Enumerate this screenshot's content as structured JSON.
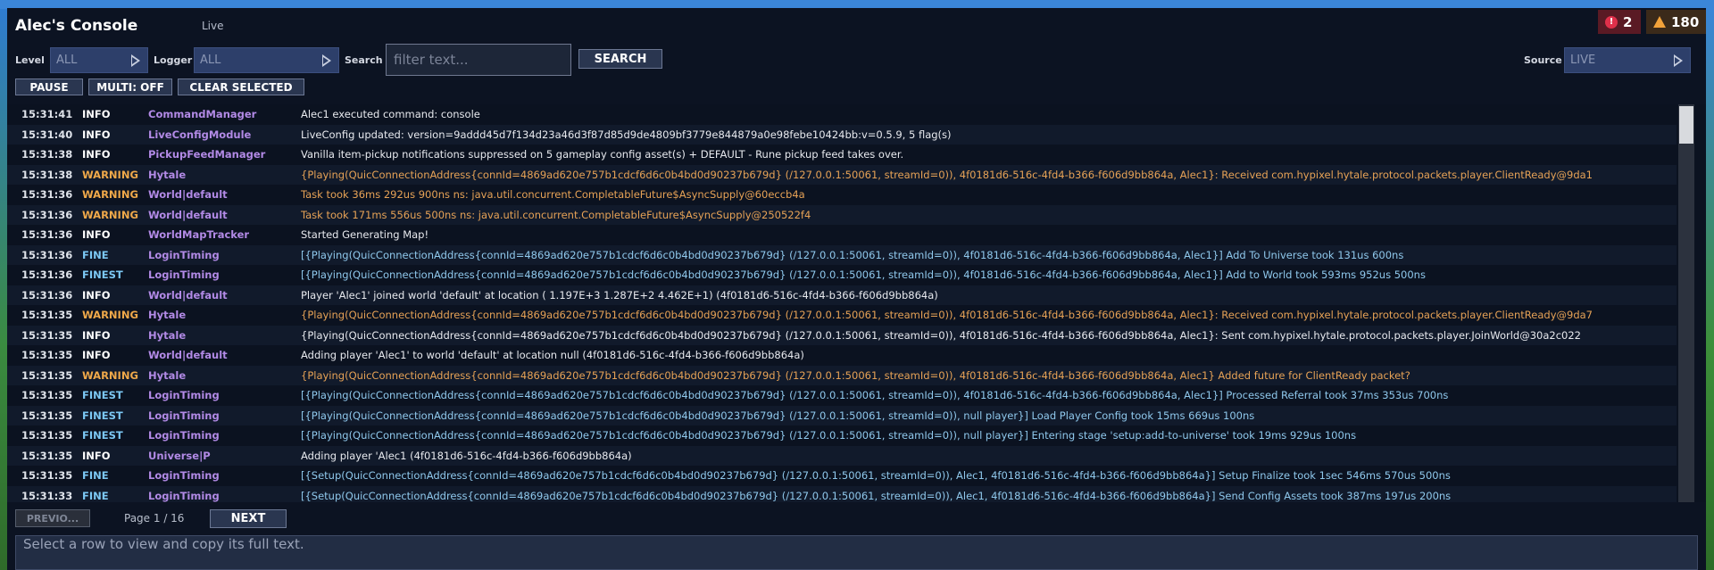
{
  "header": {
    "title": "Alec's Console",
    "status": "Live"
  },
  "counts": {
    "errors": "2",
    "warnings": "180"
  },
  "filters": {
    "level_label": "Level",
    "level_value": "ALL",
    "logger_label": "Logger",
    "logger_value": "ALL",
    "search_label": "Search",
    "search_placeholder": "filter text...",
    "search_button": "SEARCH",
    "source_label": "Source",
    "source_value": "LIVE"
  },
  "toolbar": {
    "pause": "PAUSE",
    "multi": "MULTI: OFF",
    "clear_selected": "CLEAR SELECTED"
  },
  "rows": [
    {
      "time": "15:31:41",
      "level": "INFO",
      "logger": "CommandManager",
      "message": "Alec1 executed command: console"
    },
    {
      "time": "15:31:40",
      "level": "INFO",
      "logger": "LiveConfigModule",
      "message": "LiveConfig updated: version=9addd45d7f134d23a46d3f87d85d9de4809bf3779e844879a0e98febe10424bb:v=0.5.9, 5 flag(s)"
    },
    {
      "time": "15:31:38",
      "level": "INFO",
      "logger": "PickupFeedManager",
      "message": "Vanilla item-pickup notifications suppressed on 5 gameplay config asset(s) + DEFAULT - Rune pickup feed takes over."
    },
    {
      "time": "15:31:38",
      "level": "WARNING",
      "logger": "Hytale",
      "message": "{Playing(QuicConnectionAddress{connId=4869ad620e757b1cdcf6d6c0b4bd0d90237b679d} (/127.0.0.1:50061, streamId=0)), 4f0181d6-516c-4fd4-b366-f606d9bb864a, Alec1}: Received com.hypixel.hytale.protocol.packets.player.ClientReady@9da1"
    },
    {
      "time": "15:31:36",
      "level": "WARNING",
      "logger": "World|default",
      "message": "Task took 36ms 292us 900ns ns: java.util.concurrent.CompletableFuture$AsyncSupply@60eccb4a"
    },
    {
      "time": "15:31:36",
      "level": "WARNING",
      "logger": "World|default",
      "message": "Task took 171ms 556us 500ns ns: java.util.concurrent.CompletableFuture$AsyncSupply@250522f4"
    },
    {
      "time": "15:31:36",
      "level": "INFO",
      "logger": "WorldMapTracker",
      "message": "Started Generating Map!"
    },
    {
      "time": "15:31:36",
      "level": "FINE",
      "logger": "LoginTiming",
      "message": "[{Playing(QuicConnectionAddress{connId=4869ad620e757b1cdcf6d6c0b4bd0d90237b679d} (/127.0.0.1:50061, streamId=0)), 4f0181d6-516c-4fd4-b366-f606d9bb864a, Alec1}] Add To Universe took 131us 600ns"
    },
    {
      "time": "15:31:36",
      "level": "FINEST",
      "logger": "LoginTiming",
      "message": "[{Playing(QuicConnectionAddress{connId=4869ad620e757b1cdcf6d6c0b4bd0d90237b679d} (/127.0.0.1:50061, streamId=0)), 4f0181d6-516c-4fd4-b366-f606d9bb864a, Alec1}] Add to World took 593ms 952us 500ns"
    },
    {
      "time": "15:31:36",
      "level": "INFO",
      "logger": "World|default",
      "message": "Player 'Alec1' joined world 'default' at location ( 1.197E+3  1.287E+2  4.462E+1) (4f0181d6-516c-4fd4-b366-f606d9bb864a)"
    },
    {
      "time": "15:31:35",
      "level": "WARNING",
      "logger": "Hytale",
      "message": "{Playing(QuicConnectionAddress{connId=4869ad620e757b1cdcf6d6c0b4bd0d90237b679d} (/127.0.0.1:50061, streamId=0)), 4f0181d6-516c-4fd4-b366-f606d9bb864a, Alec1}: Received com.hypixel.hytale.protocol.packets.player.ClientReady@9da7"
    },
    {
      "time": "15:31:35",
      "level": "INFO",
      "logger": "Hytale",
      "message": "{Playing(QuicConnectionAddress{connId=4869ad620e757b1cdcf6d6c0b4bd0d90237b679d} (/127.0.0.1:50061, streamId=0)), 4f0181d6-516c-4fd4-b366-f606d9bb864a, Alec1}: Sent com.hypixel.hytale.protocol.packets.player.JoinWorld@30a2c022"
    },
    {
      "time": "15:31:35",
      "level": "INFO",
      "logger": "World|default",
      "message": "Adding player 'Alec1' to world 'default' at location null (4f0181d6-516c-4fd4-b366-f606d9bb864a)"
    },
    {
      "time": "15:31:35",
      "level": "WARNING",
      "logger": "Hytale",
      "message": "{Playing(QuicConnectionAddress{connId=4869ad620e757b1cdcf6d6c0b4bd0d90237b679d} (/127.0.0.1:50061, streamId=0)), 4f0181d6-516c-4fd4-b366-f606d9bb864a, Alec1} Added future for ClientReady packet?"
    },
    {
      "time": "15:31:35",
      "level": "FINEST",
      "logger": "LoginTiming",
      "message": "[{Playing(QuicConnectionAddress{connId=4869ad620e757b1cdcf6d6c0b4bd0d90237b679d} (/127.0.0.1:50061, streamId=0)), 4f0181d6-516c-4fd4-b366-f606d9bb864a, Alec1}] Processed Referral took 37ms 353us 700ns"
    },
    {
      "time": "15:31:35",
      "level": "FINEST",
      "logger": "LoginTiming",
      "message": "[{Playing(QuicConnectionAddress{connId=4869ad620e757b1cdcf6d6c0b4bd0d90237b679d} (/127.0.0.1:50061, streamId=0)), null player}] Load Player Config took 15ms 669us 100ns"
    },
    {
      "time": "15:31:35",
      "level": "FINEST",
      "logger": "LoginTiming",
      "message": "[{Playing(QuicConnectionAddress{connId=4869ad620e757b1cdcf6d6c0b4bd0d90237b679d} (/127.0.0.1:50061, streamId=0)), null player}] Entering stage 'setup:add-to-universe' took 19ms 929us 100ns"
    },
    {
      "time": "15:31:35",
      "level": "INFO",
      "logger": "Universe|P",
      "message": "Adding player 'Alec1 (4f0181d6-516c-4fd4-b366-f606d9bb864a)"
    },
    {
      "time": "15:31:35",
      "level": "FINE",
      "logger": "LoginTiming",
      "message": "[{Setup(QuicConnectionAddress{connId=4869ad620e757b1cdcf6d6c0b4bd0d90237b679d} (/127.0.0.1:50061, streamId=0)), Alec1, 4f0181d6-516c-4fd4-b366-f606d9bb864a}] Setup Finalize took 1sec 546ms 570us 500ns"
    },
    {
      "time": "15:31:33",
      "level": "FINE",
      "logger": "LoginTiming",
      "message": "[{Setup(QuicConnectionAddress{connId=4869ad620e757b1cdcf6d6c0b4bd0d90237b679d} (/127.0.0.1:50061, streamId=0)), Alec1, 4f0181d6-516c-4fd4-b366-f606d9bb864a}] Send Config Assets took 387ms 197us 200ns"
    }
  ],
  "pagination": {
    "prev": "PREVIO...",
    "page": "Page 1 / 16",
    "next": "NEXT"
  },
  "detail": {
    "placeholder": "Select a row to view and copy its full text."
  }
}
